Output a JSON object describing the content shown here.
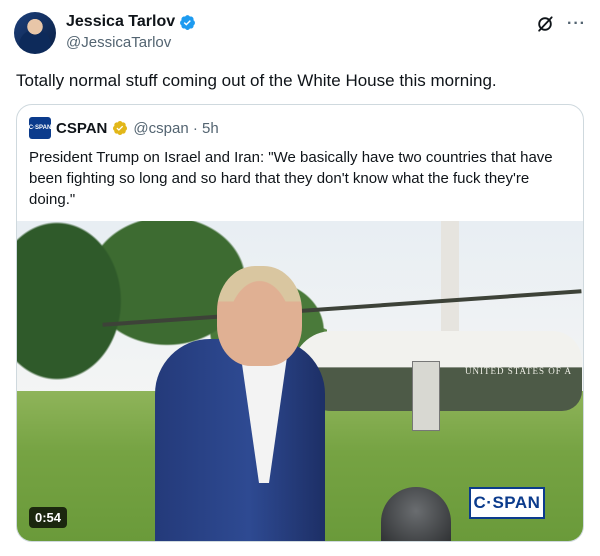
{
  "author": {
    "name": "Jessica Tarlov",
    "handle": "@JessicaTarlov"
  },
  "post": {
    "text": "Totally normal stuff coming out of the White House this morning."
  },
  "top_actions": {
    "grok_icon": "slash-circle-icon",
    "more_label": "···"
  },
  "quote": {
    "logo_text": "C·SPAN",
    "name": "CSPAN",
    "handle_time": "@cspan · 5h",
    "text": "President Trump on Israel and Iran: \"We basically have two countries that have been fighting so long and so hard that they don't know what the fuck they're doing.\""
  },
  "media": {
    "duration": "0:54",
    "watermark": "C·SPAN",
    "helicopter_text": "UNITED STATES OF A"
  },
  "colors": {
    "verified_blue": "#1d9bf0",
    "verified_gold": "#e2b719",
    "cspan_blue": "#0b3b8c",
    "muted_text": "#536471"
  }
}
